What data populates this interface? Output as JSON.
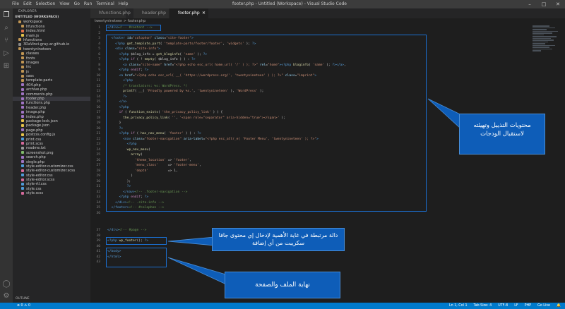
{
  "titlebar": {
    "menu": [
      "File",
      "Edit",
      "Selection",
      "View",
      "Go",
      "Run",
      "Terminal",
      "Help"
    ],
    "title": "footer.php - Untitled (Workspace) - Visual Studio Code"
  },
  "sidebar": {
    "header": "EXPLORER",
    "workspace": "UNTITLED (WORKSPACE)",
    "items": [
      "workspace",
      "hfunctions",
      "index.html",
      "main.js",
      "hfunctions",
      "3DaVinci-gray-ar.github.io",
      "twentynineteen",
      "classes",
      "fonts",
      "images",
      "inc",
      "js",
      "sass",
      "template-parts",
      "404.php",
      "archive.php",
      "comments.php",
      "footer.php",
      "functions.php",
      "header.php",
      "image.php",
      "index.php",
      "package-lock.json",
      "package.json",
      "page.php",
      "postcss.config.js",
      "print.css",
      "print.scss",
      "readme.txt",
      "screenshot.png",
      "search.php",
      "single.php",
      "style-editor-customizer.css",
      "style-editor-customizer.scss",
      "style-editor.css",
      "style-editor.scss",
      "style-rtl.css",
      "style.css",
      "style.scss"
    ],
    "outline": "OUTLINE"
  },
  "tabs": [
    {
      "label": "hfunctions.php"
    },
    {
      "label": "header.php"
    },
    {
      "label": "footer.php"
    }
  ],
  "breadcrumb": "twentynineteen  >  footer.php",
  "callouts": {
    "c1": "محتويات التذييل وتهيئته لاستقبال الودجات",
    "c2": "دالة مرتبطة في غاية الأهمية لإدخال إي محتوى جافا سكريبت من أي إضافة",
    "c3": "نهاية الملف والصفحة"
  },
  "status": {
    "left": "⊗ 0  ⚠ 0",
    "ln": "Ln 1, Col 1",
    "spaces": "Tab Size: 4",
    "enc": "UTF-8",
    "eol": "LF",
    "lang": "PHP",
    "golive": "Go Live"
  }
}
